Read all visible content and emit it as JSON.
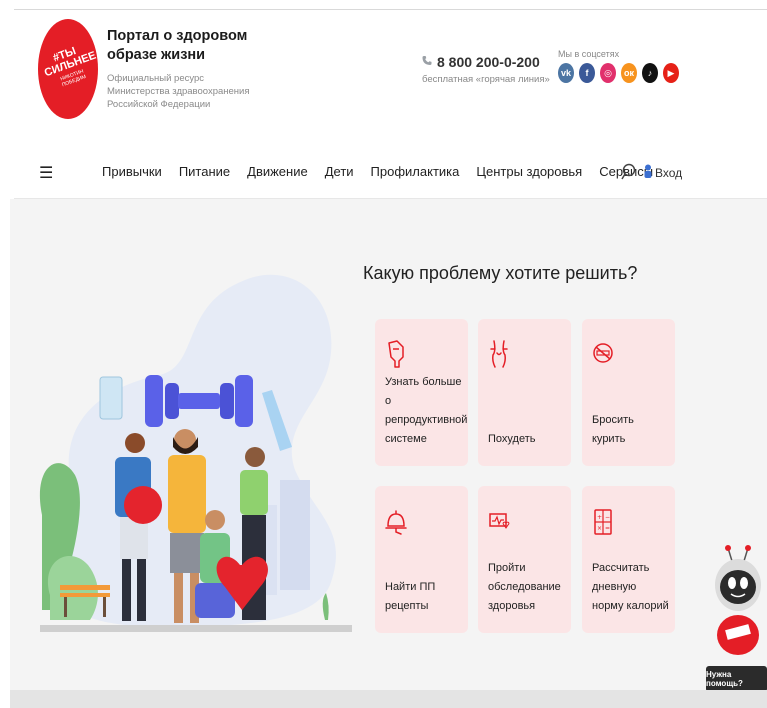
{
  "header": {
    "logo": {
      "text": "#ТЫ СИЛЬНЕЕ",
      "subtext": "НИКОТИН ПОБЕДИМ",
      "color": "#e41e26"
    },
    "brand_title": "Портал о здоровом образе жизни",
    "brand_subtitle": "Официальный ресурс Министерства здравоохранения Российской Федерации",
    "phone": {
      "icon": "phone-icon",
      "number": "8 800 200-0-200",
      "caption": "бесплатная «горячая линия»"
    },
    "social": {
      "label": "Мы в соцсетях",
      "items": [
        {
          "name": "vk",
          "glyph": "vk",
          "color": "#4c75a3"
        },
        {
          "name": "facebook",
          "glyph": "f",
          "color": "#3b5998"
        },
        {
          "name": "instagram",
          "glyph": "◎",
          "color": "#e1306c"
        },
        {
          "name": "odnoklassniki",
          "glyph": "ок",
          "color": "#f7931e"
        },
        {
          "name": "tiktok",
          "glyph": "♪",
          "color": "#111111"
        },
        {
          "name": "youtube",
          "glyph": "▶",
          "color": "#e62117"
        }
      ]
    }
  },
  "nav": {
    "menu_glyph": "☰",
    "items": [
      "Привычки",
      "Питание",
      "Движение",
      "Дети",
      "Профилактика",
      "Центры здоровья",
      "Сервисы"
    ],
    "login_label": "Вход"
  },
  "hero": {
    "question": "Какую проблему хотите решить?",
    "cards": [
      {
        "icon": "uterus-icon",
        "label": "Узнать больше о репродуктивной системе"
      },
      {
        "icon": "body-waist-icon",
        "label": "Похудеть"
      },
      {
        "icon": "no-smoking-icon",
        "label": "Бросить курить"
      },
      {
        "icon": "cloche-icon",
        "label": "Найти ПП рецепты"
      },
      {
        "icon": "health-monitor-icon",
        "label": "Пройти обследование здоровья"
      },
      {
        "icon": "calculator-icon",
        "label": "Рассчитать дневную норму калорий"
      }
    ]
  },
  "assistant": {
    "help_label": "Нужна помощь?"
  },
  "colors": {
    "accent": "#e41e26",
    "card_bg": "#fbe5e6",
    "hero_bg": "#f4f4f4"
  }
}
